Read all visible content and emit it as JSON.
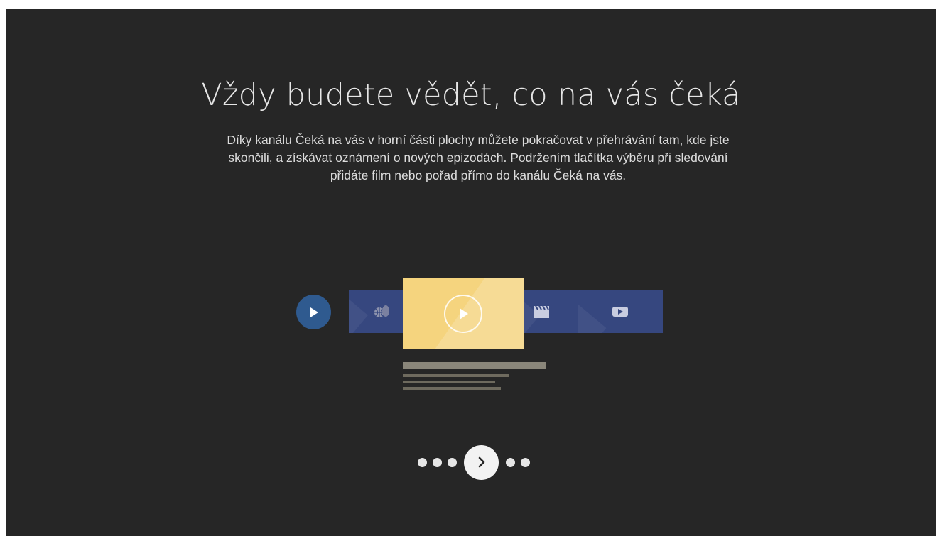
{
  "onboarding": {
    "title": "Vždy budete vědět, co na vás čeká",
    "description": "Díky kanálu Čeká na vás v horní části plochy můžete pokračovat v přehrávání tam, kde jste skončili, a získávat oznámení o nových epizodách. Podržením tlačítka výběru při sledování přidáte film nebo pořad přímo do kanálu Čeká na vás."
  },
  "illustration": {
    "row_icon": "play-circle-icon",
    "tiles": [
      {
        "icon": "sports-ball-icon"
      },
      {
        "icon": "play-featured-icon"
      },
      {
        "icon": "clapperboard-icon"
      },
      {
        "icon": "youtube-play-icon"
      }
    ]
  },
  "pager": {
    "total_pages": 6,
    "current_index": 3,
    "next_icon": "chevron-right-icon"
  },
  "colors": {
    "background": "#262626",
    "accent_blue": "#2f5a8f",
    "tile_blue": "#36477f",
    "featured_yellow": "#f5d47e",
    "text": "#e6e6e6"
  }
}
